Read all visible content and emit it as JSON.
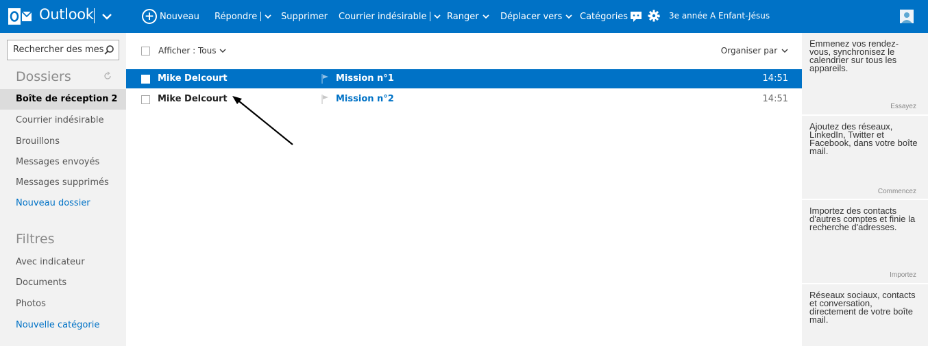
{
  "app": {
    "name": "Outlook",
    "brand_color": "#0072c6"
  },
  "toolbar": {
    "new_label": "Nouveau",
    "reply_label": "Répondre",
    "delete_label": "Supprimer",
    "junk_label": "Courrier indésirable",
    "sweep_label": "Ranger",
    "move_label": "Déplacer vers",
    "categories_label": "Catégories",
    "more_label": "•••",
    "icons": [
      "chat-icon",
      "settings-gear-icon"
    ],
    "user_name": "3e année A Enfant-Jésus"
  },
  "sidebar": {
    "search_placeholder": "Rechercher des mes",
    "folders_heading": "Dossiers",
    "folders": [
      {
        "label": "Boîte de réception",
        "count": "2",
        "selected": true
      },
      {
        "label": "Courrier indésirable"
      },
      {
        "label": "Brouillons"
      },
      {
        "label": "Messages envoyés"
      },
      {
        "label": "Messages supprimés"
      },
      {
        "label": "Nouveau dossier",
        "link": true
      }
    ],
    "filters_heading": "Filtres",
    "filters": [
      {
        "label": "Avec indicateur"
      },
      {
        "label": "Documents"
      },
      {
        "label": "Photos"
      },
      {
        "label": "Nouvelle catégorie",
        "link": true
      }
    ]
  },
  "list": {
    "filter_label": "Afficher : Tous",
    "organize_label": "Organiser par",
    "messages": [
      {
        "sender": "Mike Delcourt",
        "subject": "Mission n°1",
        "time": "14:51",
        "selected": true
      },
      {
        "sender": "Mike Delcourt",
        "subject": "Mission n°2",
        "time": "14:51",
        "selected": false
      }
    ]
  },
  "ads": [
    {
      "text": "Emmenez vos rendez-vous, synchronisez le calendrier sur tous les appareils.",
      "link": "Essayez"
    },
    {
      "text": "Ajoutez des réseaux, LinkedIn, Twitter et Facebook, dans votre boîte mail.",
      "link": "Commencez"
    },
    {
      "text": "Importez des contacts d'autres comptes et finie la recherche d'adresses.",
      "link": "Importez"
    },
    {
      "text": "Réseaux sociaux, contacts et conversation, directement de votre boîte mail.",
      "link": ""
    }
  ]
}
